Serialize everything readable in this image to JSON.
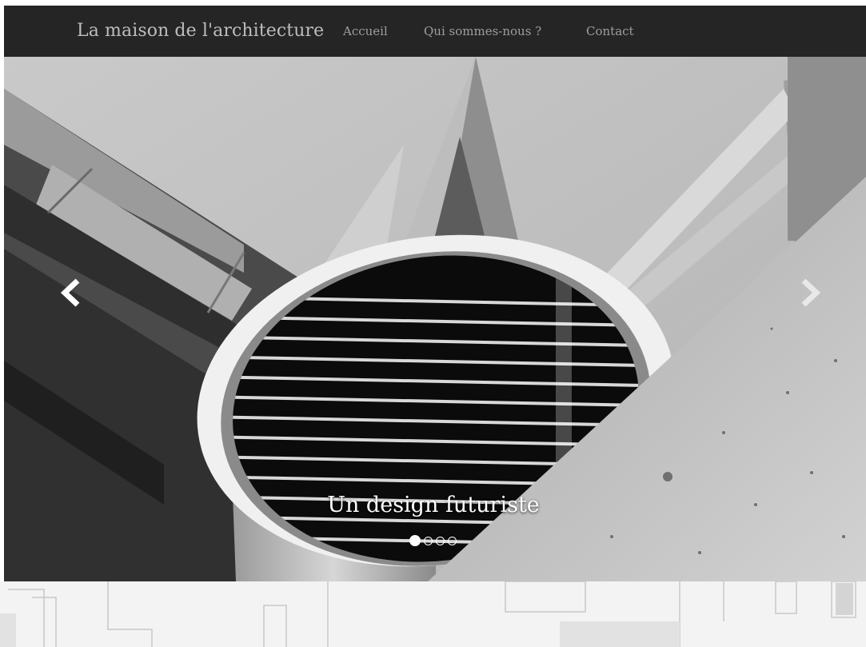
{
  "nav": {
    "brand": "La maison de l'architecture",
    "links": [
      {
        "label": "Accueil"
      },
      {
        "label": "Qui sommes-nous ?"
      },
      {
        "label": "Contact"
      }
    ]
  },
  "carousel": {
    "caption": "Un design futuriste",
    "slide_count": 4,
    "active_index": 0,
    "controls": {
      "prev_icon": "chevron-left-icon",
      "next_icon": "chevron-right-icon"
    }
  },
  "colors": {
    "navbar_bg": "#252525",
    "brand_text": "#bdbdbd",
    "link_text": "#9e9e9e"
  }
}
